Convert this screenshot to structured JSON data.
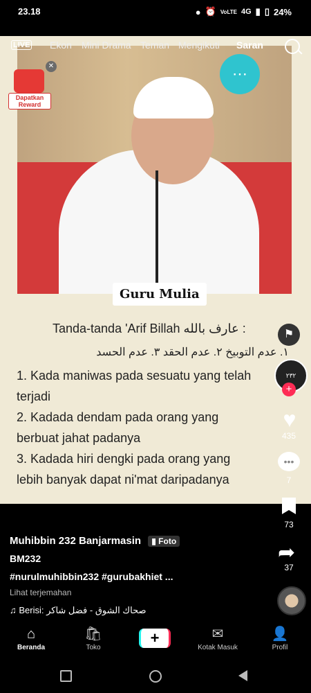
{
  "status": {
    "time": "23.18",
    "battery": "24%",
    "network": "4G",
    "volte": "VoLTE"
  },
  "topnav": {
    "live": "LIVE",
    "tabs": [
      "Ekon",
      "Mini Drama",
      "Teman",
      "Mengikuti",
      "Saran"
    ],
    "active": "Saran"
  },
  "reward": {
    "label": "Dapatkan Reward"
  },
  "post": {
    "caption_name": "Guru Mulia",
    "title": "Tanda-tanda 'Arif Billah عارف بالله :",
    "arabic": "١. عدم التوبيخ    ٢. عدم الحقد    ٣. عدم الحسد",
    "lines": [
      "1. Kada maniwas pada sesuatu yang telah",
      "terjadi",
      "2. Kadada dendam pada orang yang",
      "berbuat jahat padanya",
      "3. Kadada hiri dengki pada orang yang",
      "lebih banyak dapat ni'mat daripadanya"
    ]
  },
  "rail": {
    "avatar_text": "٢٣٢",
    "likes": "435",
    "comments": "7",
    "bookmarks": "73",
    "shares": "37"
  },
  "info": {
    "author": "Muhibbin 232 Banjarmasin",
    "badge": "Foto",
    "desc1": "BM232",
    "desc2": "#nurulmuhibbin232 #gurubakhiet ...",
    "translate": "Lihat terjemahan",
    "sound": "Berisi: صحاك الشوق - فضل شاكر"
  },
  "bottomnav": {
    "items": [
      {
        "label": "Beranda",
        "icon": "home-icon"
      },
      {
        "label": "Toko",
        "icon": "shop-icon"
      },
      {
        "label": "",
        "icon": "create-icon"
      },
      {
        "label": "Kotak Masuk",
        "icon": "inbox-icon"
      },
      {
        "label": "Profil",
        "icon": "profile-icon"
      }
    ]
  }
}
